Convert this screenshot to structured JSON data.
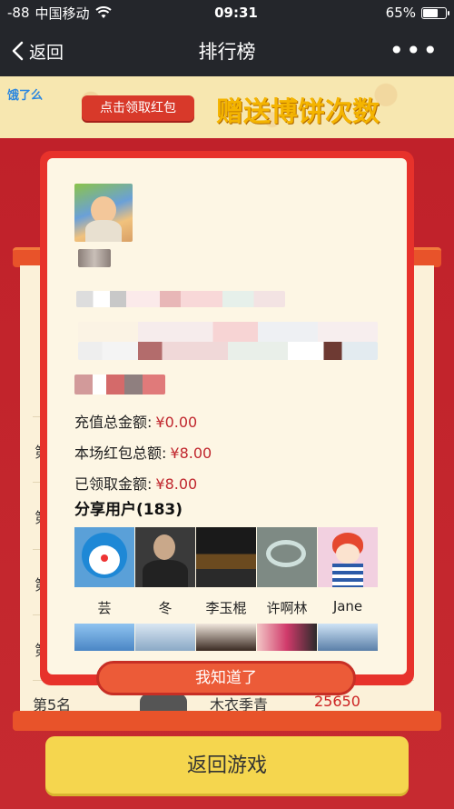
{
  "status_bar": {
    "signal": "-88",
    "carrier": "中国移动",
    "time": "09:31",
    "battery": "65%",
    "battery_level": 0.65
  },
  "nav": {
    "back_label": "返回",
    "title": "排行榜",
    "more_label": "•••"
  },
  "banner": {
    "logo": "饿了么",
    "button_label": "点击领取红包",
    "slogan": "赠送博饼次数"
  },
  "leaderboard": {
    "rank_label": "第5名",
    "rank_peek_char": "第",
    "row5_name": "木衣季青",
    "row5_score": "25650"
  },
  "modal": {
    "amounts": [
      {
        "label": "充值总金额:",
        "value": "¥0.00"
      },
      {
        "label": "本场红包总额:",
        "value": "¥8.00"
      },
      {
        "label": "已领取金额:",
        "value": "¥8.00"
      }
    ],
    "share_title": "分享用户(183)",
    "share_users": [
      "芸",
      "冬",
      "李玉棍",
      "许啊林",
      "Jane"
    ],
    "confirm_label": "我知道了"
  },
  "footer": {
    "play_label": "返回游戏"
  }
}
